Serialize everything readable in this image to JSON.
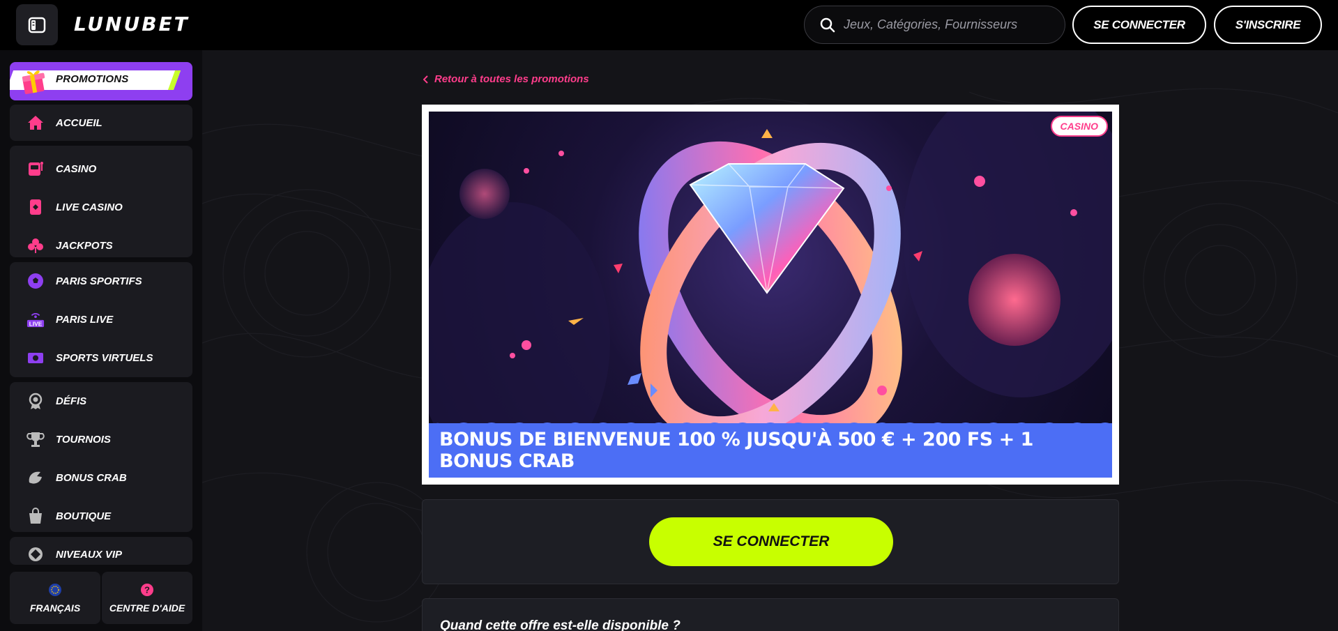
{
  "header": {
    "logo": "LUNUBET",
    "search_placeholder": "Jeux, Catégories, Fournisseurs",
    "login_label": "SE CONNECTER",
    "signup_label": "S'INSCRIRE"
  },
  "sidebar": {
    "promotions": "PROMOTIONS",
    "items": [
      {
        "label": "ACCUEIL",
        "icon": "home-icon"
      },
      {
        "label": "CASINO",
        "icon": "slot-machine-icon"
      },
      {
        "label": "LIVE CASINO",
        "icon": "card-icon"
      },
      {
        "label": "JACKPOTS",
        "icon": "clover-icon"
      },
      {
        "label": "PARIS SPORTIFS",
        "icon": "soccer-ball-icon"
      },
      {
        "label": "PARIS LIVE",
        "icon": "live-icon"
      },
      {
        "label": "SPORTS VIRTUELS",
        "icon": "virtual-sports-icon"
      },
      {
        "label": "DÉFIS",
        "icon": "badge-icon"
      },
      {
        "label": "TOURNOIS",
        "icon": "trophy-icon"
      },
      {
        "label": "BONUS CRAB",
        "icon": "crab-claw-icon"
      },
      {
        "label": "BOUTIQUE",
        "icon": "shopping-bag-icon"
      },
      {
        "label": "NIVEAUX VIP",
        "icon": "vip-icon"
      }
    ],
    "language": "FRANÇAIS",
    "help": "CENTRE D'AIDE",
    "live_badge": "LIVE"
  },
  "main": {
    "back_link": "Retour à toutes les promotions",
    "badge": "CASINO",
    "banner_title": "BONUS DE BIENVENUE 100 % JUSQU'À 500 € + 200 FS + 1 BONUS CRAB",
    "login_button": "SE CONNECTER",
    "faq_title": "Quand cette offre est-elle disponible ?"
  },
  "colors": {
    "accent_pink": "#ff3d8b",
    "accent_lime": "#c8ff00",
    "banner_blue": "#4c6ef5",
    "promo_purple": "#8e3ff0"
  }
}
